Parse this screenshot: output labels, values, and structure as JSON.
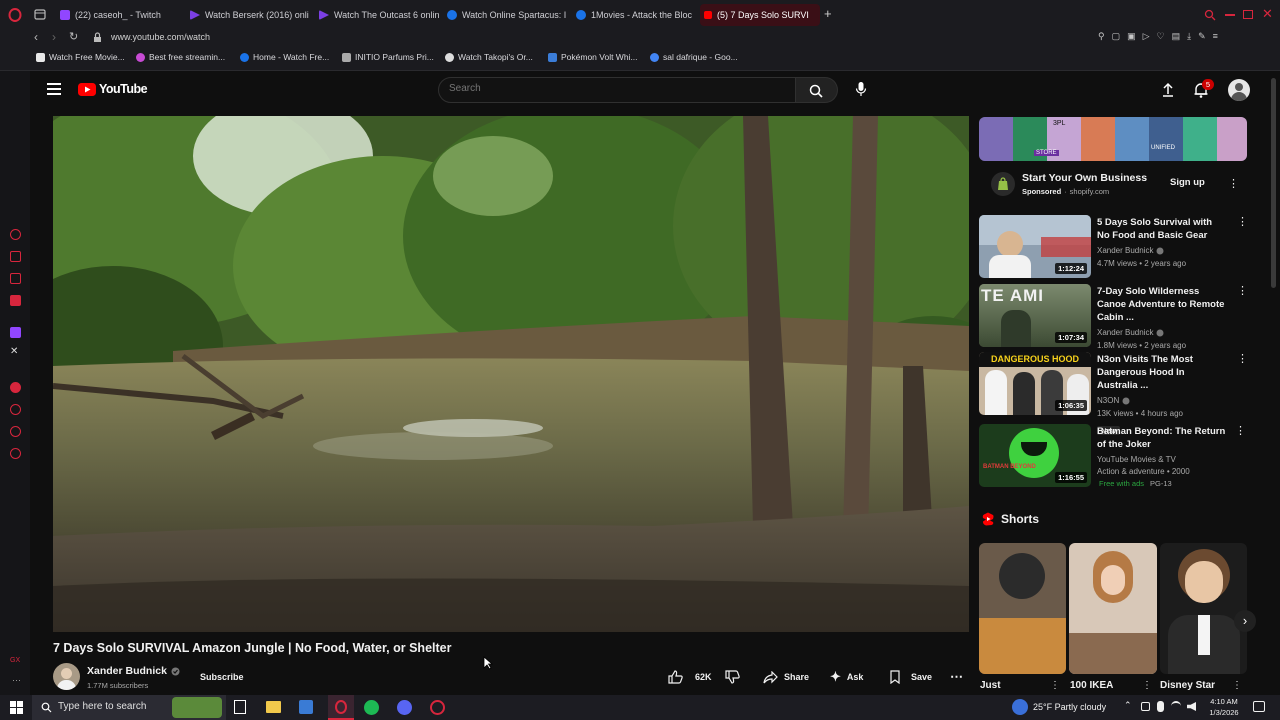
{
  "browser": {
    "tabs": [
      {
        "label": "(22) caseoh_ - Twitch",
        "color": "#9146ff"
      },
      {
        "label": "Watch Berserk (2016) onli",
        "color": "#7b3fe4"
      },
      {
        "label": "Watch The Outcast 6 onlin",
        "color": "#7b3fe4"
      },
      {
        "label": "Watch Online Spartacus: I",
        "color": "#1a73e8"
      },
      {
        "label": "1Movies - Attack the Block",
        "color": "#1a73e8"
      },
      {
        "label": "(5) 7 Days Solo SURVI",
        "color": "#ff0000"
      }
    ],
    "url": "www.youtube.com/watch",
    "bookmarks": [
      {
        "label": "Watch Free Movie...",
        "color": "#e8e8e8"
      },
      {
        "label": "Best free streamin...",
        "color": "#c74bd4"
      },
      {
        "label": "Home - Watch Fre...",
        "color": "#1a73e8"
      },
      {
        "label": "INITIO Parfums Pri...",
        "color": "#aaaaaa"
      },
      {
        "label": "Watch Takopi's Or...",
        "color": "#dddddd"
      },
      {
        "label": "Pokémon Volt Whi...",
        "color": "#3b7dd8"
      },
      {
        "label": "sal dafrique - Goo...",
        "color": "#4285f4"
      }
    ]
  },
  "youtube": {
    "logo_text": "YouTube",
    "search_placeholder": "Search",
    "notification_count": "5",
    "video": {
      "title": "7 Days Solo SURVIVAL Amazon Jungle | No Food, Water, or Shelter",
      "channel": "Xander Budnick",
      "subscribers": "1.77M subscribers",
      "subscribe_label": "Subscribe",
      "likes": "62K",
      "share_label": "Share",
      "ask_label": "Ask",
      "save_label": "Save"
    },
    "ad": {
      "title": "Start Your Own Business",
      "sponsored": "Sponsored",
      "domain": "shopify.com",
      "cta": "Sign up",
      "banner_texts": [
        "3PL",
        "UNIFIED",
        "STORE"
      ]
    },
    "recommendations": [
      {
        "title": "5 Days Solo Survival with No Food and Basic Gear",
        "channel": "Xander Budnick",
        "verified": true,
        "stats": "4.7M views • 2 years ago",
        "duration": "1:12:24",
        "thumb_text": ""
      },
      {
        "title": "7-Day Solo Wilderness Canoe Adventure to Remote Cabin ...",
        "channel": "Xander Budnick",
        "verified": true,
        "stats": "1.8M views • 2 years ago",
        "duration": "1:07:34",
        "thumb_text": "TE  AMI"
      },
      {
        "title": "N3on Visits The Most Dangerous Hood In Australia ...",
        "channel": "N3ON",
        "verified": true,
        "stats": "13K views • 4 hours ago",
        "badge": "New",
        "duration": "1:06:35",
        "thumb_text": "DANGEROUS HOOD"
      },
      {
        "title": "Batman Beyond: The Return of the Joker",
        "channel": "YouTube Movies & TV",
        "verified": false,
        "stats": "Action & adventure • 2000",
        "free": "Free with ads",
        "rating": "PG-13",
        "duration": "1:16:55",
        "thumb_text": "BATMAN BEYOND"
      }
    ],
    "shorts_label": "Shorts",
    "shorts": [
      {
        "title": "Just"
      },
      {
        "title": "100 IKEA"
      },
      {
        "title": "Disney Star"
      }
    ]
  },
  "taskbar": {
    "search_placeholder": "Type here to search",
    "weather": "25°F  Partly cloudy",
    "time": "4:10 AM",
    "date": "1/3/2026"
  },
  "colors": {
    "background": "#0f0f0f",
    "accent": "#ff0000",
    "browser_chrome": "#1b1b1f",
    "opera_red": "#d7263d"
  }
}
